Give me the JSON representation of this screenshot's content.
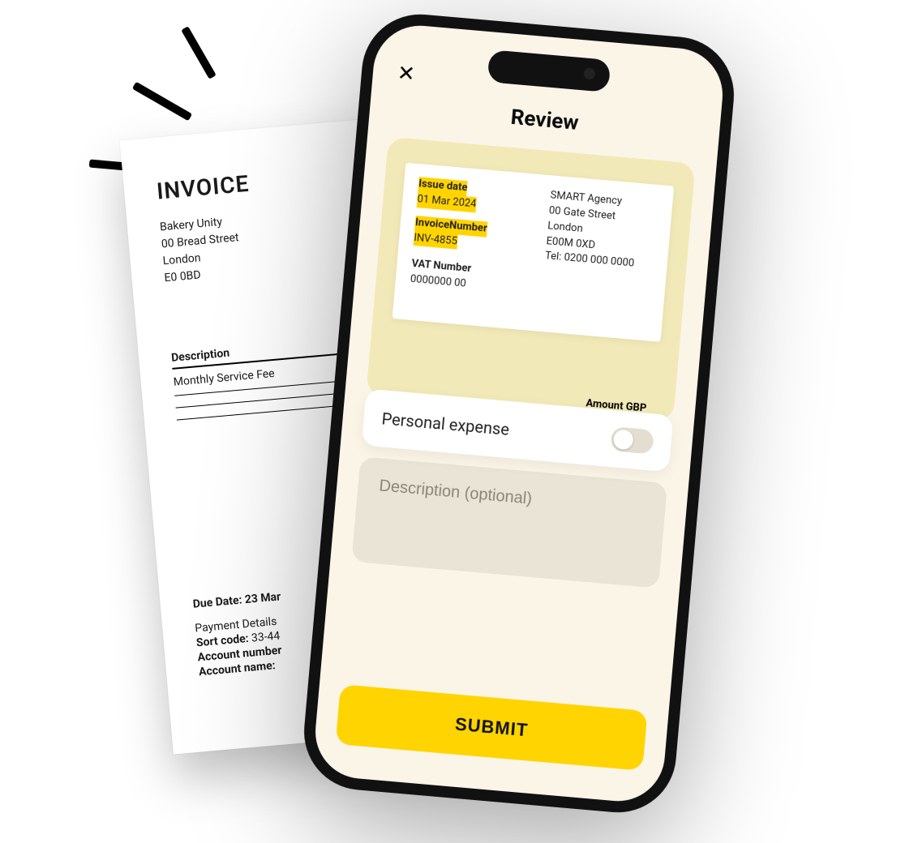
{
  "paper": {
    "title": "INVOICE",
    "vendor": {
      "name": "Bakery Unity",
      "street": "00 Bread Street",
      "city": "London",
      "postcode": "E0 0BD"
    },
    "table_header": "Description",
    "line_item": "Monthly Service Fee",
    "due_label": "Due Date:",
    "due_value": "23 Mar",
    "payment_details_label": "Payment Details",
    "sort_code_label": "Sort code:",
    "sort_code_value": "33-44",
    "account_number_label": "Account number",
    "account_name_label": "Account name:"
  },
  "app": {
    "title": "Review",
    "close_label": "✕",
    "invoice_preview": {
      "issue_date_label": "Issue date",
      "issue_date_value": "01 Mar 2024",
      "invoice_number_label": "InvoiceNumber",
      "invoice_number_value": "INV-4855",
      "vat_label": "VAT Number",
      "vat_value": "0000000 00",
      "to": {
        "name": "SMART Agency",
        "street": "00 Gate Street",
        "city": "London",
        "postcode": "E00M 0XD",
        "tel_label": "Tel:",
        "tel_value": "0200 000 0000"
      },
      "amount_label": "Amount GBP"
    },
    "personal_expense_label": "Personal expense",
    "personal_expense_on": false,
    "description_placeholder": "Description (optional)",
    "submit_label": "SUBMIT"
  },
  "colors": {
    "accent_yellow": "#ffd400",
    "screen_bg": "#fbf5e8",
    "preview_panel": "#f2e9b8"
  }
}
